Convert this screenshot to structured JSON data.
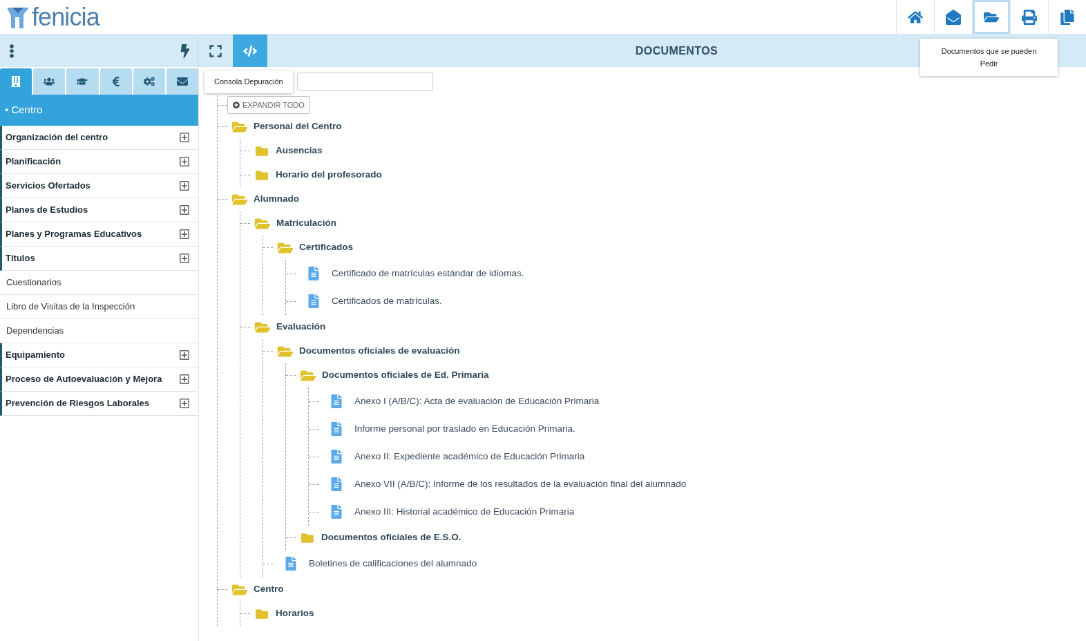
{
  "header": {
    "logo_text": "fenicia",
    "actions": [
      {
        "kind": "home",
        "selected": false
      },
      {
        "kind": "mail",
        "selected": false
      },
      {
        "kind": "folder",
        "selected": true
      },
      {
        "kind": "print",
        "selected": false
      },
      {
        "kind": "copy",
        "selected": false
      }
    ],
    "tooltip": "Documentos que se pueden Pedir"
  },
  "toolbar": {
    "view_buttons": [
      {
        "kind": "fullscreen",
        "selected": false
      },
      {
        "kind": "code",
        "selected": true
      }
    ],
    "tooltip": "Consola Depuración",
    "title": "DOCUMENTOS"
  },
  "sidebar": {
    "tabs": [
      {
        "kind": "building",
        "selected": true
      },
      {
        "kind": "users",
        "selected": false
      },
      {
        "kind": "graduation",
        "selected": false
      },
      {
        "kind": "euro",
        "selected": false
      },
      {
        "kind": "cogs",
        "selected": false
      },
      {
        "kind": "mail",
        "selected": false
      }
    ],
    "section_title": "• Centro",
    "items": [
      {
        "label": "Organización del centro",
        "expandable": true
      },
      {
        "label": "Planificación",
        "expandable": true
      },
      {
        "label": "Servicios Ofertados",
        "expandable": true
      },
      {
        "label": "Planes de Estudios",
        "expandable": true
      },
      {
        "label": "Planes y Programas Educativos",
        "expandable": true
      },
      {
        "label": "Títulos",
        "expandable": true
      },
      {
        "label": "Cuestionarios",
        "expandable": false
      },
      {
        "label": "Libro de Visitas de la Inspección",
        "expandable": false
      },
      {
        "label": "Dependencias",
        "expandable": false
      },
      {
        "label": "Equipamiento",
        "expandable": true
      },
      {
        "label": "Proceso de Autoevaluación y Mejora",
        "expandable": true
      },
      {
        "label": "Prevención de Riesgos Laborales",
        "expandable": true
      }
    ]
  },
  "tree": {
    "expand_all_label": "EXPANDIR TODO",
    "items": [
      {
        "kind": "folder",
        "label": "Personal del Centro",
        "expanded": true,
        "children": [
          {
            "kind": "folder",
            "label": "Ausencias",
            "expanded": false
          },
          {
            "kind": "folder",
            "label": "Horario del profesorado",
            "expanded": false
          }
        ]
      },
      {
        "kind": "folder",
        "label": "Alumnado",
        "expanded": true,
        "children": [
          {
            "kind": "folder",
            "label": "Matriculación",
            "expanded": true,
            "children": [
              {
                "kind": "folder",
                "label": "Certificados",
                "expanded": true,
                "children": [
                  {
                    "kind": "document",
                    "label": "Certificado de matrículas estándar de idiomas."
                  },
                  {
                    "kind": "document",
                    "label": "Certificados de matrículas."
                  }
                ]
              }
            ]
          },
          {
            "kind": "folder",
            "label": "Evaluación",
            "expanded": true,
            "children": [
              {
                "kind": "folder",
                "label": "Documentos oficiales de evaluación",
                "expanded": true,
                "children": [
                  {
                    "kind": "folder",
                    "label": "Documentos oficiales de Ed. Primaria",
                    "expanded": true,
                    "children": [
                      {
                        "kind": "document",
                        "label": "Anexo I (A/B/C): Acta de evaluación de Educación Primaria"
                      },
                      {
                        "kind": "document",
                        "label": "Informe personal por traslado en Educación Primaria."
                      },
                      {
                        "kind": "document",
                        "label": "Anexo II: Expediente académico de Educación Primaria"
                      },
                      {
                        "kind": "document",
                        "label": "Anexo VII (A/B/C): Informe de los resultados de la evaluación final del alumnado"
                      },
                      {
                        "kind": "document",
                        "label": "Anexo III: Historial académico de Educación Primaria"
                      }
                    ]
                  },
                  {
                    "kind": "folder",
                    "label": "Documentos oficiales de E.S.O.",
                    "expanded": false
                  }
                ]
              },
              {
                "kind": "document",
                "label": "Boletines de calificaciones del alumnado"
              }
            ]
          }
        ]
      },
      {
        "kind": "folder",
        "label": "Centro",
        "expanded": true,
        "children": [
          {
            "kind": "folder",
            "label": "Horarios",
            "expanded": false
          }
        ]
      }
    ]
  }
}
